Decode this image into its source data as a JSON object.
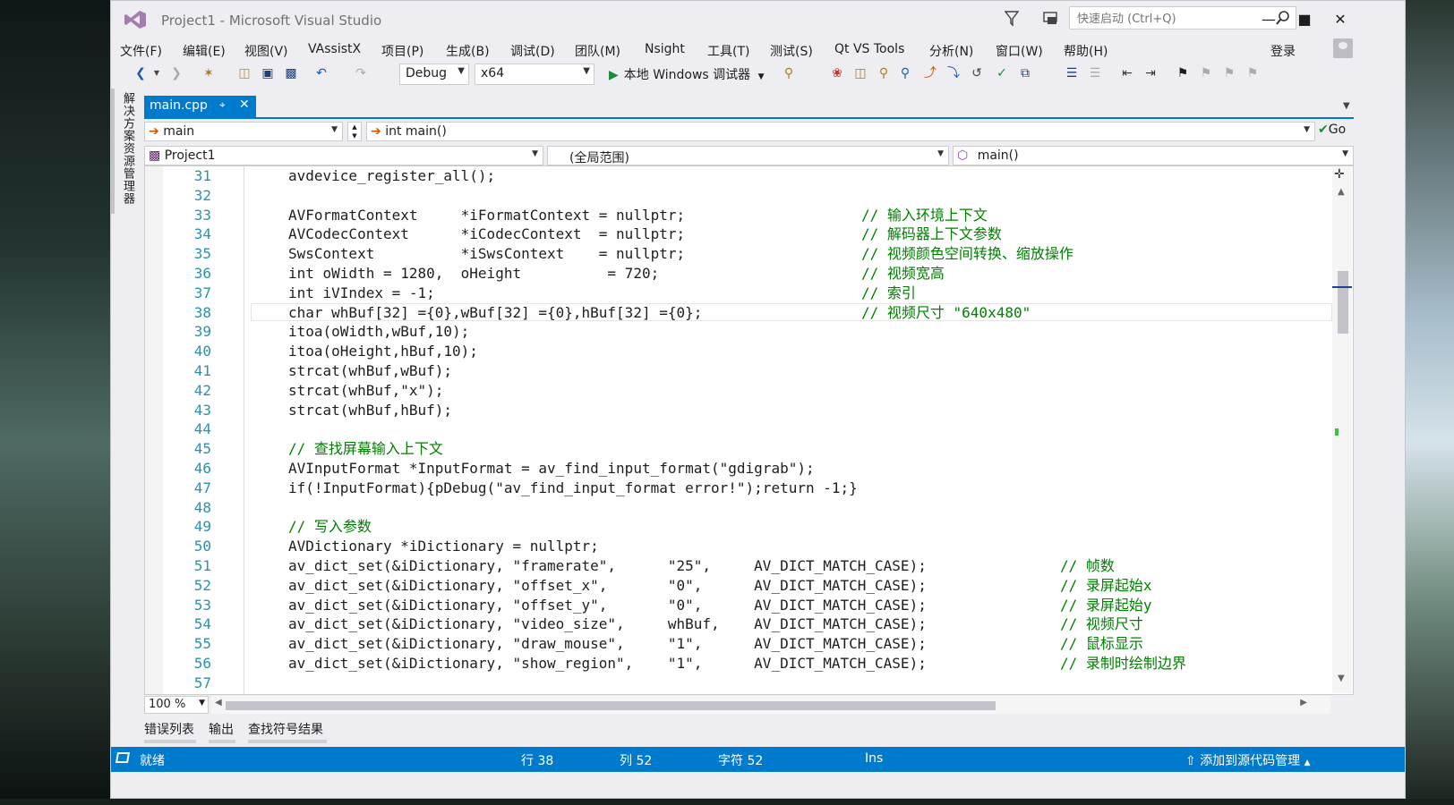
{
  "window": {
    "title": "Project1 - Microsoft Visual Studio",
    "quick_launch_placeholder": "快速启动 (Ctrl+Q)",
    "login": "登录"
  },
  "menu": [
    "文件(F)",
    "编辑(E)",
    "视图(V)",
    "VAssistX",
    "项目(P)",
    "生成(B)",
    "调试(D)",
    "团队(M)",
    "Nsight",
    "工具(T)",
    "测试(S)",
    "Qt VS Tools",
    "分析(N)",
    "窗口(W)",
    "帮助(H)"
  ],
  "toolbar": {
    "config": "Debug",
    "platform": "x64",
    "run_label": "本地 Windows 调试器"
  },
  "side_panel": {
    "label": "解决方案资源管理器"
  },
  "doc_tab": {
    "name": "main.cpp"
  },
  "nav": {
    "symbol": "main",
    "signature": "int main()",
    "go": "Go",
    "project": "Project1",
    "scope": "(全局范围)",
    "member": "main()"
  },
  "code_lines": [
    {
      "n": "31",
      "code": "avdevice_register_all();",
      "comment": ""
    },
    {
      "n": "32",
      "code": "",
      "comment": ""
    },
    {
      "n": "33",
      "code": "AVFormatContext     *iFormatContext = nullptr;",
      "comment": "// 输入环境上下文"
    },
    {
      "n": "34",
      "code": "AVCodecContext      *iCodecContext  = nullptr;",
      "comment": "// 解码器上下文参数"
    },
    {
      "n": "35",
      "code": "SwsContext          *iSwsContext    = nullptr;",
      "comment": "// 视频颜色空间转换、缩放操作"
    },
    {
      "n": "36",
      "code": "int oWidth = 1280,  oHeight          = 720;",
      "comment": "// 视频宽高"
    },
    {
      "n": "37",
      "code": "int iVIndex = -1;",
      "comment": "// 索引"
    },
    {
      "n": "38",
      "code": "char whBuf[32] ={0},wBuf[32] ={0},hBuf[32] ={0};",
      "comment": "// 视频尺寸 \"640x480\""
    },
    {
      "n": "39",
      "code": "itoa(oWidth,wBuf,10);",
      "comment": ""
    },
    {
      "n": "40",
      "code": "itoa(oHeight,hBuf,10);",
      "comment": ""
    },
    {
      "n": "41",
      "code": "strcat(whBuf,wBuf);",
      "comment": ""
    },
    {
      "n": "42",
      "code": "strcat(whBuf,\"x\");",
      "comment": ""
    },
    {
      "n": "43",
      "code": "strcat(whBuf,hBuf);",
      "comment": ""
    },
    {
      "n": "44",
      "code": "",
      "comment": ""
    },
    {
      "n": "45",
      "code": "",
      "comment": "// 查找屏幕输入上下文"
    },
    {
      "n": "46",
      "code": "AVInputFormat *InputFormat = av_find_input_format(\"gdigrab\");",
      "comment": ""
    },
    {
      "n": "47",
      "code": "if(!InputFormat){pDebug(\"av_find_input_format error!\");return -1;}",
      "comment": ""
    },
    {
      "n": "48",
      "code": "",
      "comment": ""
    },
    {
      "n": "49",
      "code": "",
      "comment": "// 写入参数"
    },
    {
      "n": "50",
      "code": "AVDictionary *iDictionary = nullptr;",
      "comment": ""
    },
    {
      "n": "51",
      "code": "av_dict_set(&iDictionary, \"framerate\",      \"25\",     AV_DICT_MATCH_CASE);",
      "comment": "// 帧数"
    },
    {
      "n": "52",
      "code": "av_dict_set(&iDictionary, \"offset_x\",       \"0\",      AV_DICT_MATCH_CASE);",
      "comment": "// 录屏起始x"
    },
    {
      "n": "53",
      "code": "av_dict_set(&iDictionary, \"offset_y\",       \"0\",      AV_DICT_MATCH_CASE);",
      "comment": "// 录屏起始y"
    },
    {
      "n": "54",
      "code": "av_dict_set(&iDictionary, \"video_size\",     whBuf,    AV_DICT_MATCH_CASE);",
      "comment": "// 视频尺寸"
    },
    {
      "n": "55",
      "code": "av_dict_set(&iDictionary, \"draw_mouse\",     \"1\",      AV_DICT_MATCH_CASE);",
      "comment": "// 鼠标显示"
    },
    {
      "n": "56",
      "code": "av_dict_set(&iDictionary, \"show_region\",    \"1\",      AV_DICT_MATCH_CASE);",
      "comment": "// 录制时绘制边界"
    },
    {
      "n": "57",
      "code": "",
      "comment": ""
    }
  ],
  "zoom": "100 %",
  "bottom_tabs": [
    "错误列表",
    "输出",
    "查找符号结果"
  ],
  "status": {
    "ready": "就绪",
    "line": "行 38",
    "col": "列 52",
    "char": "字符 52",
    "mode": "Ins",
    "source_control": "添加到源代码管理"
  },
  "colors": {
    "accent": "#007acc",
    "line_number": "#2b91af",
    "comment": "#008000",
    "run_green": "#1e8a3a"
  }
}
